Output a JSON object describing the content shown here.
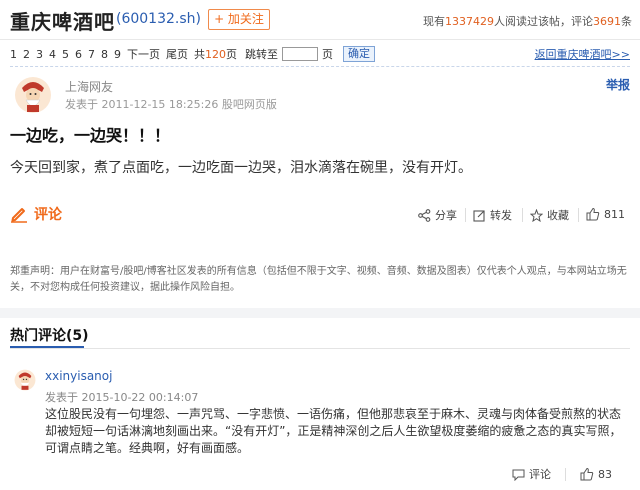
{
  "header": {
    "title": "重庆啤酒吧",
    "stock_code": "(600132.sh)",
    "follow_label": "+ 加关注",
    "stats_prefix": "现有",
    "readers": "1337429",
    "stats_middle": "人阅读过该帖，评论",
    "comments": "3691",
    "stats_suffix": "条"
  },
  "pager": {
    "pages": [
      "1",
      "2",
      "3",
      "4",
      "5",
      "6",
      "7",
      "8",
      "9"
    ],
    "next_label": "下一页",
    "last_label": "尾页",
    "total_prefix": "共",
    "total_pages": "120",
    "total_suffix": "页",
    "jump_label": "跳转至",
    "jump_suffix": "页",
    "confirm_label": "确定",
    "back_link": "返回重庆啤酒吧>>"
  },
  "post": {
    "author": "上海网友",
    "meta": "发表于 2011-12-15 18:25:26 股吧网页版",
    "report_label": "举报",
    "title": "一边吃，一边哭！！！",
    "body": "今天回到家，煮了点面吃，一边吃面一边哭，泪水滴落在碗里，没有开灯。",
    "comment_label": "评论",
    "share_label": "分享",
    "repost_label": "转发",
    "favorite_label": "收藏",
    "like_count": "811"
  },
  "disclaimer": "郑重声明：用户在财富号/股吧/博客社区发表的所有信息（包括但不限于文字、视频、音频、数据及图表）仅代表个人观点，与本网站立场无关，不对您构成任何投资建议，据此操作风险自担。",
  "hot_comments": {
    "header": "热门评论(5)",
    "items": [
      {
        "user": "xxinyisanoj",
        "time": "发表于 2015-10-22 00:14:07",
        "text": "这位股民没有一句埋怨、一声咒骂、一字悲愤、一语伤痛，但他那悲哀至于麻木、灵魂与肉体备受煎熬的状态却被短短一句话淋漓地刻画出来。“没有开灯”，正是精神深创之后人生欲望极度萎缩的疲惫之态的真实写照，可谓点睛之笔。经典啊，好有画面感。",
        "comment_label": "评论",
        "like_count": "83"
      }
    ]
  },
  "colors": {
    "accent_blue": "#2a5db0",
    "accent_orange": "#f06a1b"
  }
}
